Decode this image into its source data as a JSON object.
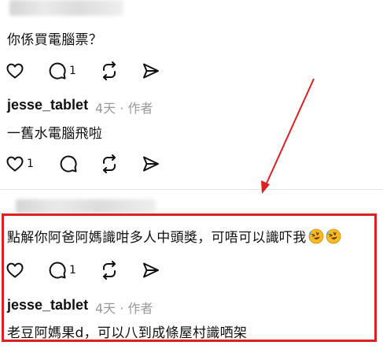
{
  "comment1": {
    "text": "你係買電腦票？"
  },
  "reply1": {
    "username": "jesse_tablet",
    "meta": "4天 · 作者",
    "text": "一舊水電腦飛啦",
    "like_count": "1"
  },
  "comment1_actions": {
    "reply_count": "1"
  },
  "comment2": {
    "text": "點解你阿爸阿媽識咁多人中頭獎，可唔可以識吓我",
    "reply_count": "1"
  },
  "reply2": {
    "username": "jesse_tablet",
    "meta": "4天 · 作者",
    "text": "老豆阿媽果d，可以八到成條屋村識哂架"
  },
  "colors": {
    "highlight": "#e02020",
    "meta": "#999999",
    "divider": "#e6e6e6"
  },
  "icons": [
    "heart-icon",
    "comment-icon",
    "repost-icon",
    "share-icon",
    "rofl-emoji"
  ]
}
